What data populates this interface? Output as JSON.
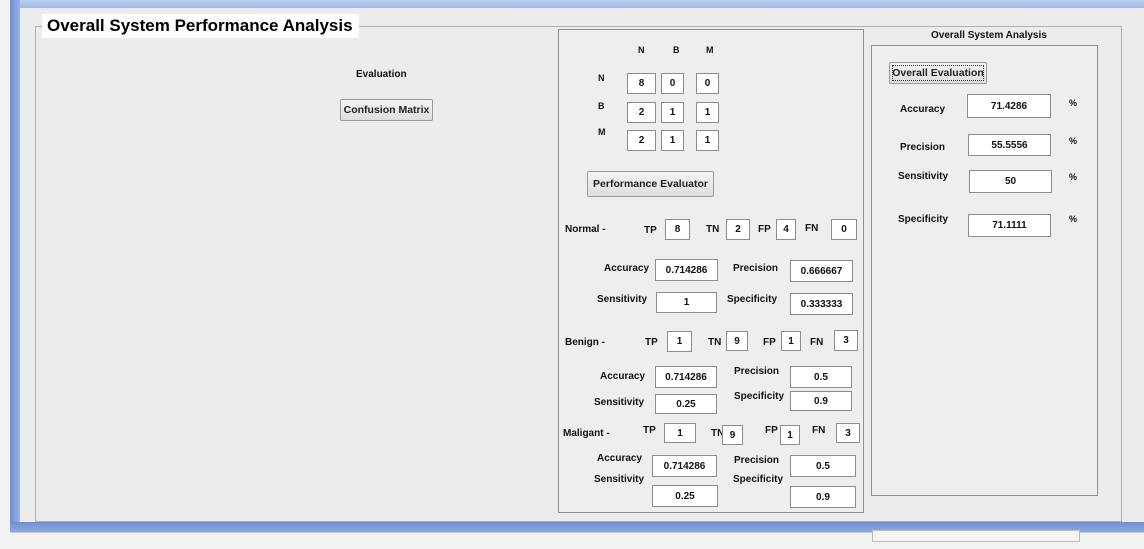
{
  "left_title": "Overall System Performance Analysis",
  "evaluation_label": "Evaluation",
  "confusion_button": "Confusion Matrix",
  "matrix": {
    "col_headers": [
      "N",
      "B",
      "M"
    ],
    "row_headers": [
      "N",
      "B",
      "M"
    ],
    "values": [
      [
        "8",
        "0",
        "0"
      ],
      [
        "2",
        "1",
        "1"
      ],
      [
        "2",
        "1",
        "1"
      ]
    ]
  },
  "evaluator_button": "Performance Evaluator",
  "labels": {
    "tp": "TP",
    "tn": "TN",
    "fp": "FP",
    "fn": "FN",
    "accuracy": "Accuracy",
    "precision": "Precision",
    "sensitivity": "Sensitivity",
    "specificity": "Specificity"
  },
  "normal": {
    "label": "Normal -",
    "tp": "8",
    "tn": "2",
    "fp": "4",
    "fn": "0",
    "accuracy": "0.714286",
    "precision": "0.666667",
    "sensitivity": "1",
    "specificity": "0.333333"
  },
  "benign": {
    "label": "Benign -",
    "tp": "1",
    "tn": "9",
    "fp": "1",
    "fn": "3",
    "accuracy": "0.714286",
    "precision": "0.5",
    "sensitivity": "0.25",
    "specificity": "0.9"
  },
  "malignant": {
    "label": "Maligant -",
    "tp": "1",
    "tn": "9",
    "fp": "1",
    "fn": "3",
    "accuracy": "0.714286",
    "precision": "0.5",
    "sensitivity": "0.25",
    "specificity": "0.9"
  },
  "overall": {
    "title": "Overall System Analysis",
    "button": "Overall Evaluation",
    "percent": "%",
    "accuracy": "71.4286",
    "precision": "55.5556",
    "sensitivity": "50",
    "specificity": "71.1111"
  }
}
